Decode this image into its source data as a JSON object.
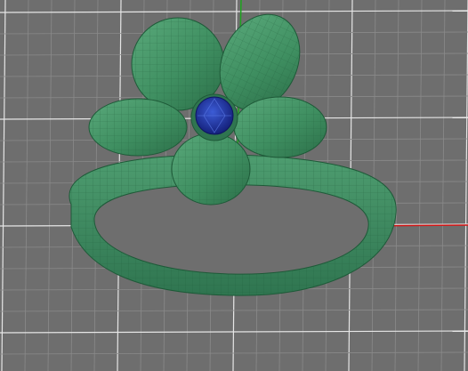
{
  "viewport": {
    "background_color": "#6e6e6e",
    "grid_color_major": "#e6e6e6",
    "grid_color_minor": "#8a8a8a",
    "axis_x_color": "#d21414",
    "axis_y_color": "#1fa31f",
    "model_color": "#3f8f61",
    "model_wire_color": "#1e5a38",
    "gem_color": "#1e2f9a",
    "icons": [
      "axis-x-icon",
      "axis-y-icon"
    ]
  }
}
